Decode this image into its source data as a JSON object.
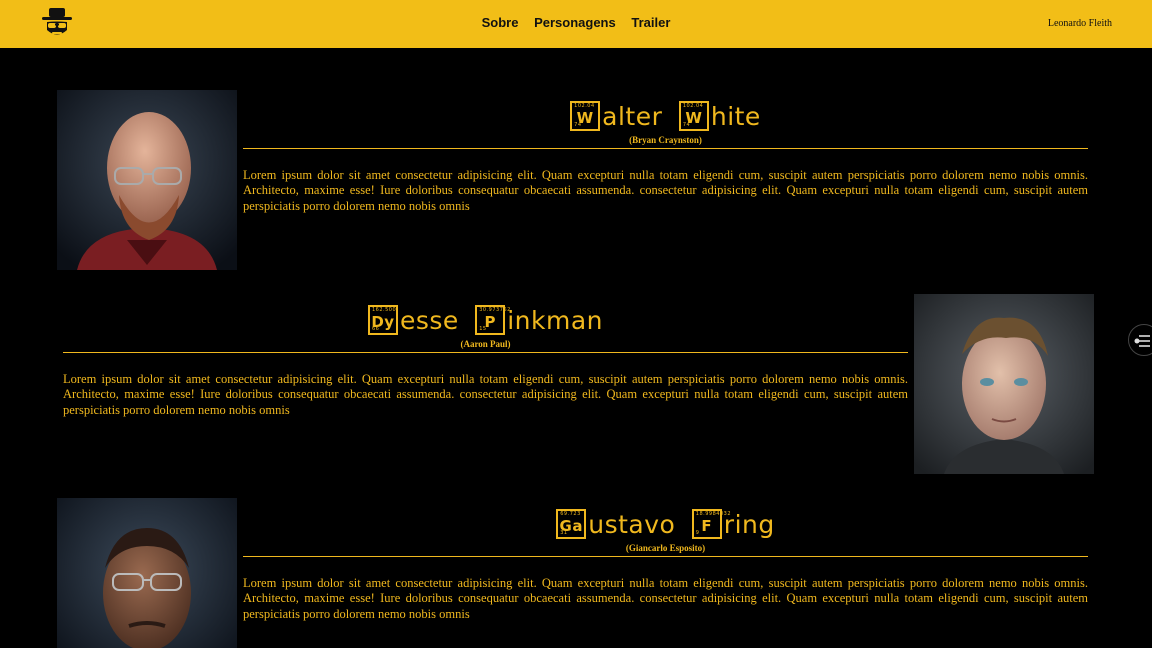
{
  "header": {
    "brand_icon": "incognito-hat-glasses-icon",
    "nav": [
      "Sobre",
      "Personagens",
      "Trailer"
    ],
    "author": "Leonardo Fleith"
  },
  "colors": {
    "accent": "#f2be17",
    "text": "#f0b81e",
    "background": "#000000"
  },
  "characters": [
    {
      "element1": {
        "num": "102.04",
        "sym": "W",
        "an": "74"
      },
      "rest1": "alter",
      "element2": {
        "num": "102.04",
        "sym": "W",
        "an": "74"
      },
      "rest2": "hite",
      "actor": "(Bryan Craynston)",
      "bio": "Lorem ipsum dolor sit amet consectetur adipisicing elit. Quam excepturi nulla totam eligendi cum, suscipit autem perspiciatis porro dolorem nemo nobis omnis. Architecto, maxime esse! Iure doloribus consequatur obcaecati assumenda. consectetur adipisicing elit. Quam excepturi nulla totam eligendi cum, suscipit autem perspiciatis porro dolorem nemo nobis omnis"
    },
    {
      "element1": {
        "num": "162.500",
        "sym": "Dy",
        "an": "66"
      },
      "rest1": "esse",
      "element2": {
        "num": "30.973762",
        "sym": "P",
        "an": "15"
      },
      "rest2": "inkman",
      "actor": "(Aaron Paul)",
      "bio": "Lorem ipsum dolor sit amet consectetur adipisicing elit. Quam excepturi nulla totam eligendi cum, suscipit autem perspiciatis porro dolorem nemo nobis omnis. Architecto, maxime esse! Iure doloribus consequatur obcaecati assumenda. consectetur adipisicing elit. Quam excepturi nulla totam eligendi cum, suscipit autem perspiciatis porro dolorem nemo nobis omnis"
    },
    {
      "element1": {
        "num": "69.723",
        "sym": "Ga",
        "an": "31"
      },
      "rest1": "ustavo",
      "element2": {
        "num": "18.9984032",
        "sym": "F",
        "an": "9"
      },
      "rest2": "ring",
      "actor": "(Giancarlo Esposito)",
      "bio": "Lorem ipsum dolor sit amet consectetur adipisicing elit. Quam excepturi nulla totam eligendi cum, suscipit autem perspiciatis porro dolorem nemo nobis omnis. Architecto, maxime esse! Iure doloribus consequatur obcaecati assumenda. consectetur adipisicing elit. Quam excepturi nulla totam eligendi cum, suscipit autem perspiciatis porro dolorem nemo nobis omnis"
    }
  ],
  "side_button": {
    "icon": "sliders-toggle-icon"
  }
}
